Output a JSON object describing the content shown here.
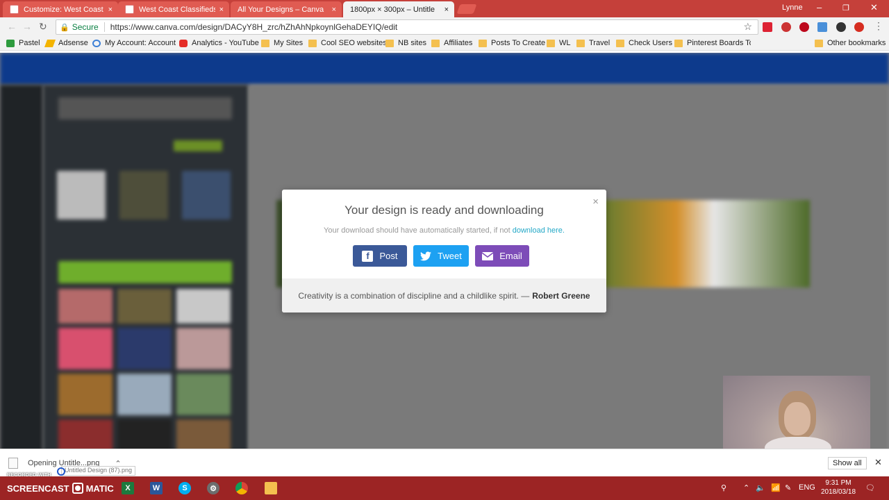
{
  "tabs": [
    {
      "title": "Customize: West Coast C",
      "close": "×",
      "icon": "document-icon"
    },
    {
      "title": "West Coast Classifieds",
      "close": "×",
      "icon": "document-icon"
    },
    {
      "title": "All Your Designs – Canva",
      "close": "×",
      "icon": "canva-icon"
    },
    {
      "title": "1800px × 300px – Untitle",
      "close": "×",
      "icon": "canva-icon",
      "active": true
    }
  ],
  "window": {
    "user": "Lynne",
    "minimize": "–",
    "restore": "❐",
    "close": "✕"
  },
  "address": {
    "secure": "Secure",
    "url": "https://www.canva.com/design/DACyY8H_zrc/hZhAhNpkoynlGehaDEYIQ/edit"
  },
  "bookmarks": [
    {
      "label": "Pastel",
      "icon": "pastel-icon",
      "color": "#2e9b3e"
    },
    {
      "label": "Adsense",
      "icon": "adsense-icon",
      "color": "#f4b400"
    },
    {
      "label": "My Account: Account",
      "icon": "account-icon",
      "color": "#3c7fd6"
    },
    {
      "label": "Analytics - YouTube",
      "icon": "youtube-icon",
      "color": "#e52d27"
    },
    {
      "label": "My Sites",
      "icon": "folder-icon"
    },
    {
      "label": "Cool SEO websites",
      "icon": "folder-icon"
    },
    {
      "label": "NB sites",
      "icon": "folder-icon"
    },
    {
      "label": "Affiliates",
      "icon": "folder-icon"
    },
    {
      "label": "Posts To Create",
      "icon": "folder-icon"
    },
    {
      "label": "WL",
      "icon": "folder-icon"
    },
    {
      "label": "Travel",
      "icon": "folder-icon"
    },
    {
      "label": "Check Users",
      "icon": "folder-icon"
    },
    {
      "label": "Pinterest Boards To A",
      "icon": "folder-icon"
    }
  ],
  "other_bookmarks": "Other bookmarks",
  "modal": {
    "title": "Your design is ready and downloading",
    "subtitle": "Your download should have automatically started, if not",
    "link": "download here.",
    "close": "×",
    "buttons": {
      "post": "Post",
      "tweet": "Tweet",
      "email": "Email"
    },
    "quote": "Creativity is a combination of discipline and a childlike spirit. —",
    "author": "Robert Greene"
  },
  "download": {
    "file": "Opening Untitle...png",
    "tooltip": "Untitled Design (87).png",
    "show_all": "Show all",
    "close": "✕"
  },
  "recorder": {
    "recorded_with": "RECORDED WITH",
    "brand_left": "SCREENCAST",
    "brand_right": "MATIC"
  },
  "tray": {
    "lang": "ENG",
    "time": "9:31 PM",
    "date": "2018/03/18"
  },
  "colors": {
    "facebook": "#3b5998",
    "twitter": "#1da1f2",
    "email": "#7d4cb8",
    "link": "#24a8c7",
    "titlebar": "#c5403a",
    "taskbar": "#9c2424"
  }
}
